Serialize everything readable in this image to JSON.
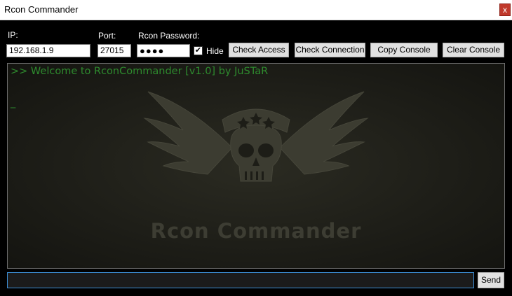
{
  "window": {
    "title": "Rcon Commander",
    "close_glyph": "x"
  },
  "form": {
    "ip_label": "IP:",
    "ip_value": "192.168.1.9",
    "port_label": "Port:",
    "port_value": "27015",
    "password_label": "Rcon Password:",
    "password_mask": "●●●●",
    "hide_checked": true,
    "hide_label": "Hide"
  },
  "buttons": {
    "check_access": "Check Access",
    "check_connection": "Check Connection",
    "copy_console": "Copy Console",
    "clear_console": "Clear Console",
    "send": "Send"
  },
  "console": {
    "welcome": ">> Welcome to RconCommander [v1.0] by JuSTaR",
    "cursor": "_",
    "logo_text": "Rcon Commander",
    "text_color": "#2e8b2e"
  },
  "command": {
    "value": ""
  },
  "icons": {
    "close": "close-icon",
    "check": "checkmark-icon",
    "logo": "winged-skull-icon",
    "text_cursor": "ibeam-cursor-icon"
  }
}
